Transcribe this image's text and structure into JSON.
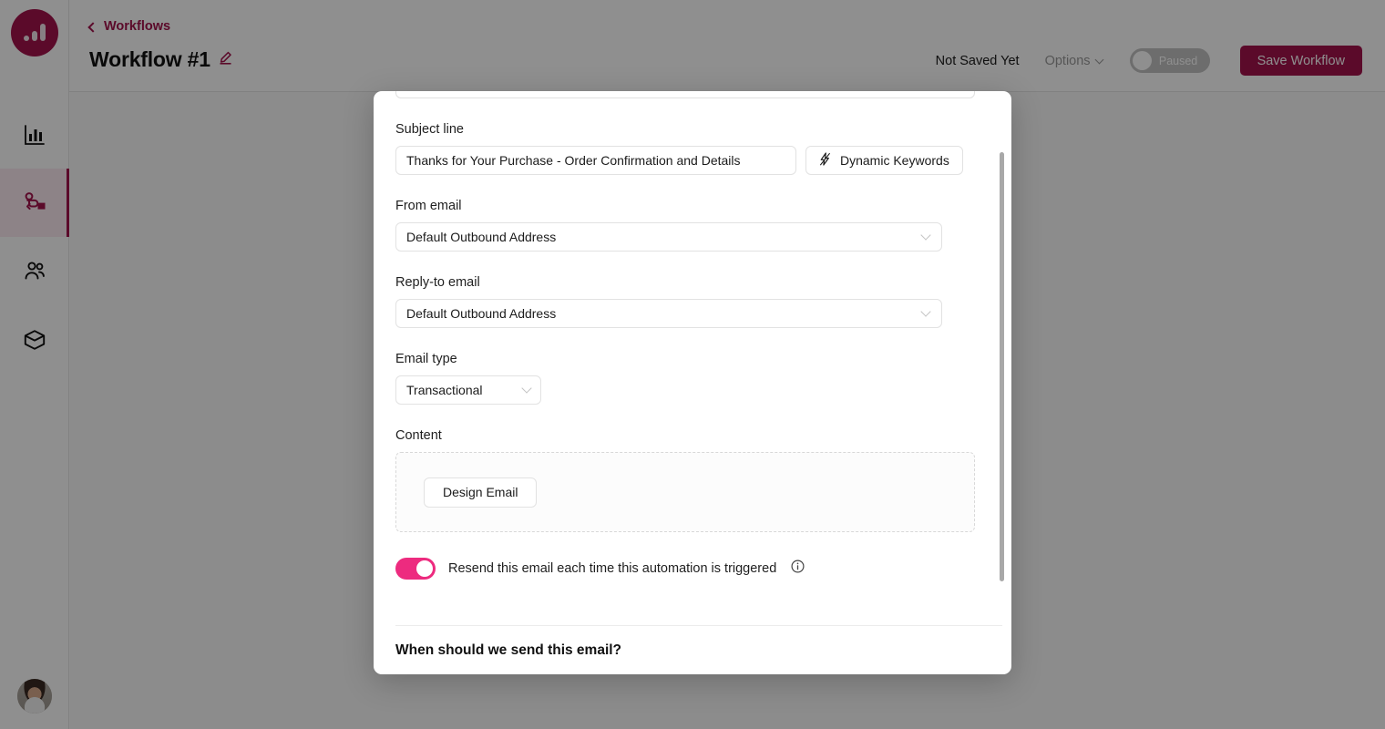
{
  "brand": {
    "primary_color": "#A3124B",
    "toggle_on_color": "#ED2B7F",
    "logo_icon": "bar-chart-logo-icon"
  },
  "sidebar": {
    "items": [
      {
        "icon": "analytics-bar-chart-icon",
        "name": "analytics",
        "active": false
      },
      {
        "icon": "workflow-route-icon",
        "name": "workflows",
        "active": true
      },
      {
        "icon": "contacts-people-icon",
        "name": "contacts",
        "active": false
      },
      {
        "icon": "package-box-icon",
        "name": "products",
        "active": false
      }
    ],
    "avatar": "user-avatar"
  },
  "header": {
    "breadcrumb": "Workflows",
    "title": "Workflow #1",
    "edit_icon": "pencil-edit-icon",
    "save_status": "Not Saved Yet",
    "options_label": "Options",
    "status_toggle_label": "Paused",
    "status_toggle_on": false,
    "save_button": "Save Workflow"
  },
  "modal": {
    "subject": {
      "label": "Subject line",
      "value": "Thanks for Your Purchase - Order Confirmation and Details",
      "placeholder": "Subject line",
      "dynamic_keywords_button": "Dynamic Keywords",
      "dynamic_keywords_icon": "lightning-bolt-icon"
    },
    "from_email": {
      "label": "From email",
      "value": "Default Outbound Address"
    },
    "reply_to_email": {
      "label": "Reply-to email",
      "value": "Default Outbound Address"
    },
    "email_type": {
      "label": "Email type",
      "value": "Transactional"
    },
    "content": {
      "label": "Content",
      "design_button": "Design Email"
    },
    "resend": {
      "label": "Resend this email each time this automation is triggered",
      "enabled": true,
      "info_icon": "info-circle-icon"
    },
    "next_section_heading": "When should we send this email?"
  }
}
